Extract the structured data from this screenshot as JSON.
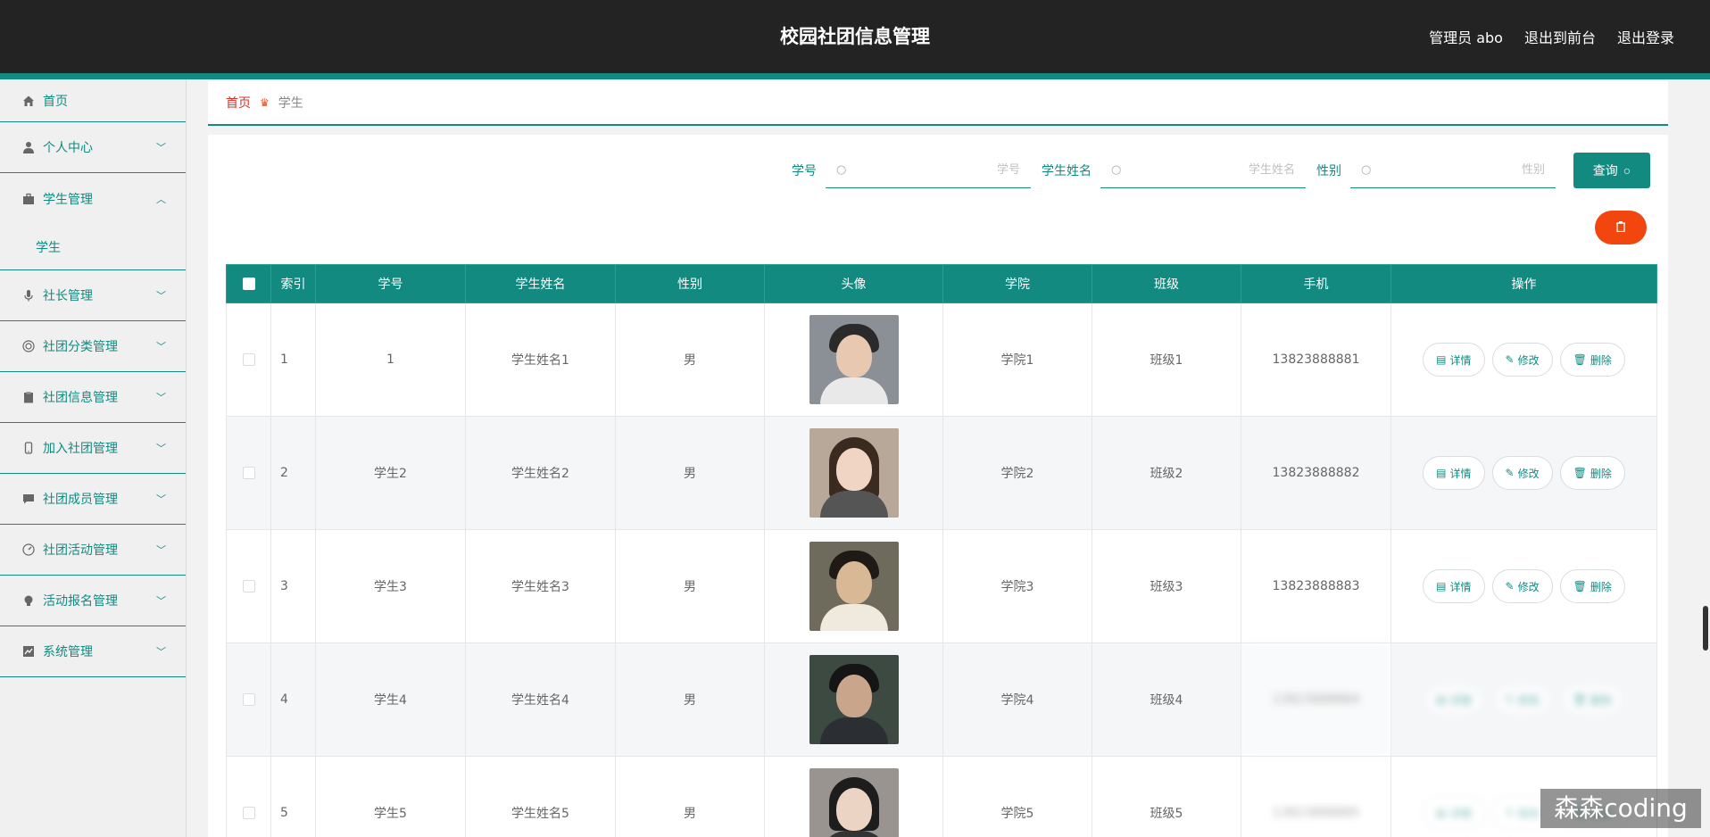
{
  "header": {
    "title": "校园社团信息管理",
    "user": "管理员 abo",
    "to_front": "退出到前台",
    "logout": "退出登录"
  },
  "sidebar": {
    "items": [
      {
        "label": "首页",
        "icon": "home-icon",
        "chevron": ""
      },
      {
        "label": "个人中心",
        "icon": "user-icon",
        "chevron": "﹀"
      },
      {
        "label": "学生管理",
        "icon": "briefcase-icon",
        "chevron": "︿",
        "sub": [
          "学生"
        ]
      },
      {
        "label": "社长管理",
        "icon": "mic-icon",
        "chevron": "﹀"
      },
      {
        "label": "社团分类管理",
        "icon": "target-icon",
        "chevron": "﹀"
      },
      {
        "label": "社团信息管理",
        "icon": "clipboard-icon",
        "chevron": "﹀"
      },
      {
        "label": "加入社团管理",
        "icon": "phone-icon",
        "chevron": "﹀"
      },
      {
        "label": "社团成员管理",
        "icon": "chat-icon",
        "chevron": "﹀"
      },
      {
        "label": "社团活动管理",
        "icon": "gauge-icon",
        "chevron": "﹀"
      },
      {
        "label": "活动报名管理",
        "icon": "bulb-icon",
        "chevron": "﹀"
      },
      {
        "label": "系统管理",
        "icon": "chart-icon",
        "chevron": "﹀"
      }
    ]
  },
  "breadcrumb": {
    "home": "首页",
    "current": "学生"
  },
  "search": {
    "f1_label": "学号",
    "f1_placeholder": "学号",
    "f2_label": "学生姓名",
    "f2_placeholder": "学生姓名",
    "f3_label": "性别",
    "f3_placeholder": "性别",
    "query_label": "查询"
  },
  "table": {
    "headers": [
      "索引",
      "学号",
      "学生姓名",
      "性别",
      "头像",
      "学院",
      "班级",
      "手机",
      "操作"
    ],
    "rows": [
      {
        "index": "1",
        "id": "1",
        "name": "学生姓名1",
        "gender": "男",
        "college": "学院1",
        "class": "班级1",
        "phone": "13823888881"
      },
      {
        "index": "2",
        "id": "学生2",
        "name": "学生姓名2",
        "gender": "男",
        "college": "学院2",
        "class": "班级2",
        "phone": "13823888882"
      },
      {
        "index": "3",
        "id": "学生3",
        "name": "学生姓名3",
        "gender": "男",
        "college": "学院3",
        "class": "班级3",
        "phone": "13823888883"
      },
      {
        "index": "4",
        "id": "学生4",
        "name": "学生姓名4",
        "gender": "男",
        "college": "学院4",
        "class": "班级4",
        "phone": "13823888884"
      },
      {
        "index": "5",
        "id": "学生5",
        "name": "学生姓名5",
        "gender": "男",
        "college": "学院5",
        "class": "班级5",
        "phone": "13823888885"
      }
    ],
    "actions": {
      "detail": "详情",
      "edit": "修改",
      "delete": "删除"
    }
  },
  "watermark": "森森coding",
  "colors": {
    "primary": "#128a80",
    "header_bg": "#232323",
    "danger": "#f2460f"
  }
}
